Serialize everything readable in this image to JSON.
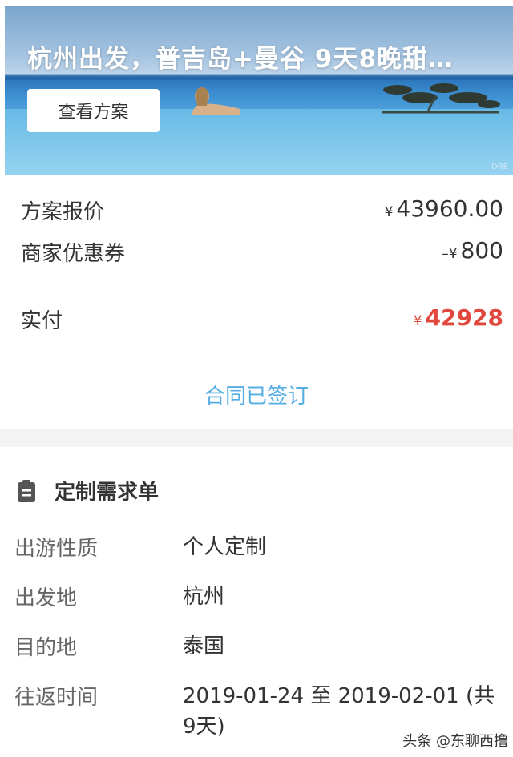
{
  "banner": {
    "title": "杭州出发，普吉岛+曼谷 9天8晚甜…",
    "view_button": "查看方案",
    "corner_mark": "DRE"
  },
  "pricing": {
    "quote_label": "方案报价",
    "quote_currency": "¥",
    "quote_value": "43960.00",
    "coupon_label": "商家优惠券",
    "coupon_prefix": "–¥",
    "coupon_value": "800",
    "paid_label": "实付",
    "paid_currency": "¥",
    "paid_value": "42928",
    "contract_status": "合同已签订"
  },
  "requirements": {
    "title": "定制需求单",
    "icon": "clipboard-icon",
    "fields": [
      {
        "key": "出游性质",
        "value": "个人定制"
      },
      {
        "key": "出发地",
        "value": "杭州"
      },
      {
        "key": "目的地",
        "value": "泰国"
      },
      {
        "key": "往返时间",
        "value": "2019-01-24 至 2019-02-01 (共9天)"
      }
    ]
  },
  "watermark": "头条 @东聊西撸",
  "colors": {
    "accent_red": "#e0483d",
    "link_blue": "#55aee3"
  }
}
